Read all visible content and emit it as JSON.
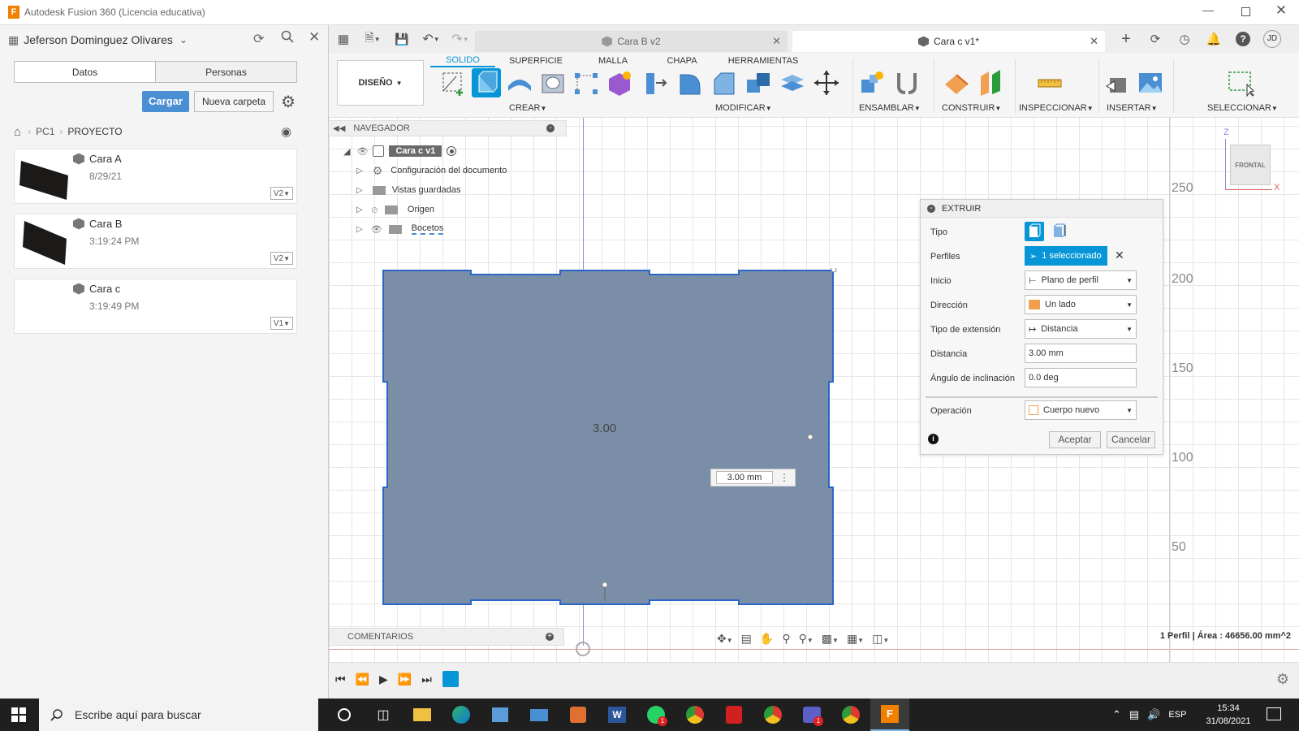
{
  "window": {
    "title": "Autodesk Fusion 360 (Licencia educativa)"
  },
  "user": {
    "name": "Jeferson Dominguez Olivares"
  },
  "data_panel": {
    "tabs": [
      "Datos",
      "Personas"
    ],
    "upload_label": "Cargar",
    "new_folder_label": "Nueva carpeta",
    "breadcrumb": [
      "PC1",
      "PROYECTO"
    ],
    "files": [
      {
        "name": "Cara A",
        "date": "8/29/21",
        "version": "V2"
      },
      {
        "name": "Cara B",
        "date": "3:19:24 PM",
        "version": "V2"
      },
      {
        "name": "Cara c",
        "date": "3:19:49 PM",
        "version": "V1"
      }
    ]
  },
  "doc_tabs": [
    {
      "label": "Cara B v2",
      "active": false
    },
    {
      "label": "Cara c v1*",
      "active": true
    }
  ],
  "header_user_initials": "JD",
  "ribbon": {
    "workspace": "DISEÑO",
    "tabs": [
      "SOLIDO",
      "SUPERFICIE",
      "MALLA",
      "CHAPA",
      "HERRAMIENTAS"
    ],
    "active_tab": "SOLIDO",
    "groups": [
      "CREAR",
      "MODIFICAR",
      "ENSAMBLAR",
      "CONSTRUIR",
      "INSPECCIONAR",
      "INSERTAR",
      "SELECCIONAR"
    ]
  },
  "navigator": {
    "title": "NAVEGADOR",
    "root": "Cara c v1",
    "items": [
      "Configuración del documento",
      "Vistas guardadas",
      "Origen",
      "Bocetos"
    ]
  },
  "viewcube": {
    "face": "FRONTAL",
    "axis_z": "Z",
    "axis_x": "X"
  },
  "grid_labels": [
    "250",
    "200",
    "150",
    "100",
    "50"
  ],
  "sketch": {
    "dimension_text": "3.00",
    "input_value": "3.00 mm"
  },
  "extrude": {
    "title": "EXTRUIR",
    "rows": [
      {
        "label": "Tipo"
      },
      {
        "label": "Perfiles",
        "value": "1 seleccionado"
      },
      {
        "label": "Inicio",
        "value": "Plano de perfil"
      },
      {
        "label": "Dirección",
        "value": "Un lado"
      },
      {
        "label": "Tipo de extensión",
        "value": "Distancia"
      },
      {
        "label": "Distancia",
        "value": "3.00 mm"
      },
      {
        "label": "Ángulo de inclinación",
        "value": "0.0 deg"
      },
      {
        "label": "Operación",
        "value": "Cuerpo nuevo"
      }
    ],
    "ok": "Aceptar",
    "cancel": "Cancelar"
  },
  "comments": {
    "label": "COMENTARIOS"
  },
  "status": {
    "text": "1 Perfil | Área : 46656.00 mm^2"
  },
  "taskbar": {
    "search_placeholder": "Escribe aquí para buscar",
    "lang": "ESP",
    "time": "15:34",
    "date": "31/08/2021",
    "badge": "1"
  },
  "colors": {
    "accent": "#0696d7",
    "sketch_fill": "#7a8ea8",
    "sketch_edge": "#2a66c8",
    "taskbar": "#1f1f1f"
  }
}
